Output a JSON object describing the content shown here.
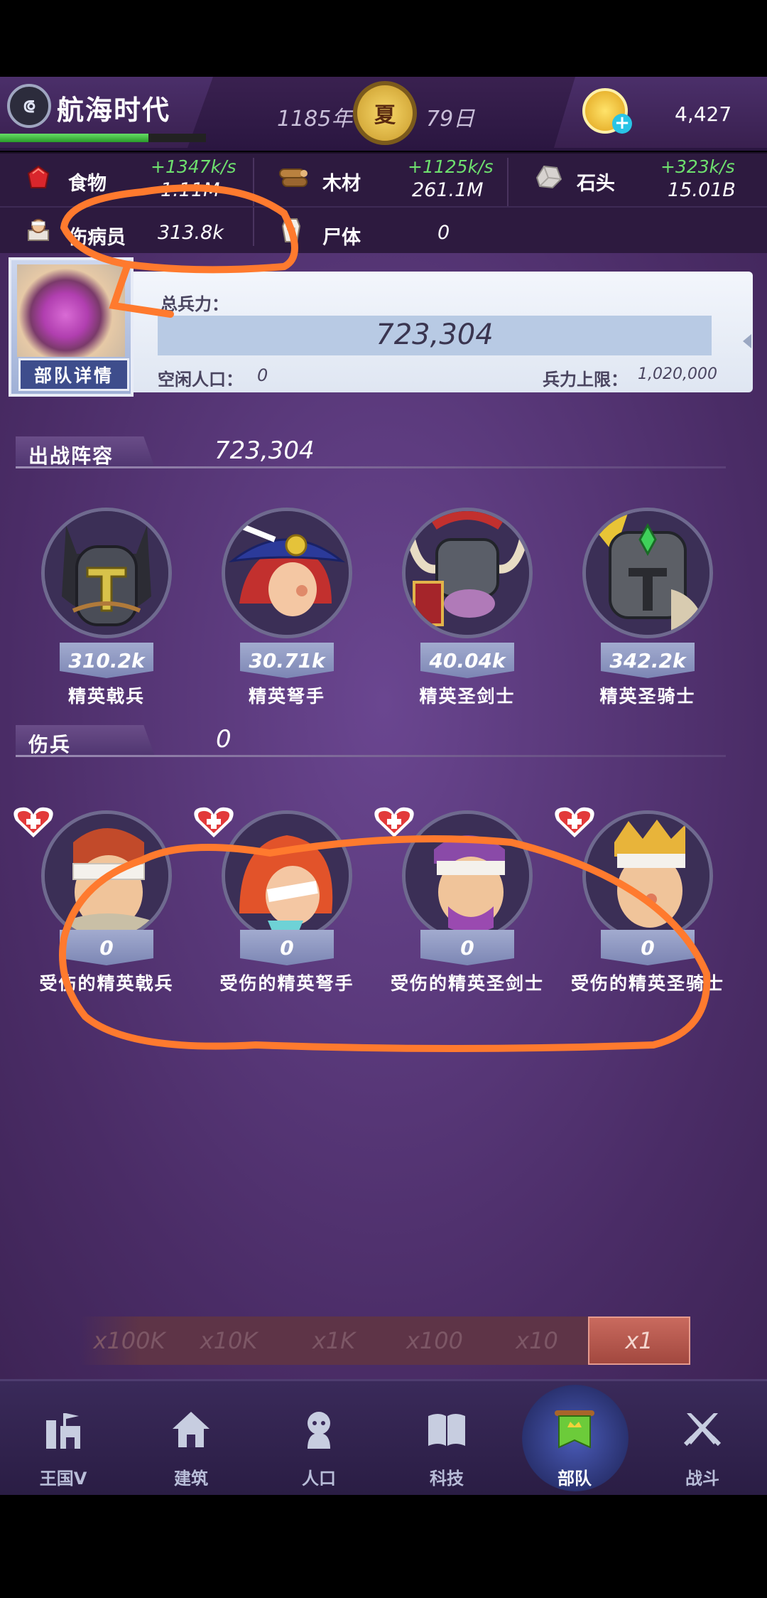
{
  "header": {
    "app_title": "航海时代",
    "era_icon": "era-badge-icon",
    "year": "1185年",
    "season": "夏",
    "day": "79日",
    "gold": "4,427",
    "xp_progress": 0.72
  },
  "resources": {
    "food": {
      "label": "食物",
      "rate": "+1347k/s",
      "value": "1.11M",
      "icon": "meat-icon"
    },
    "wood": {
      "label": "木材",
      "rate": "+1125k/s",
      "value": "261.1M",
      "icon": "log-icon"
    },
    "stone": {
      "label": "石头",
      "rate": "+323k/s",
      "value": "15.01B",
      "icon": "stone-icon"
    },
    "wounded": {
      "label": "伤病员",
      "value": "313.8k",
      "icon": "patient-icon"
    },
    "corpse": {
      "label": "尸体",
      "value": "0",
      "icon": "coffin-icon"
    }
  },
  "troops": {
    "total_label": "总兵力：",
    "total": "723,304",
    "idle_label": "空闲人口：",
    "idle_value": "0",
    "cap_label": "兵力上限：",
    "cap_value": "1,020,000",
    "detail_button": "部队详情"
  },
  "lineup": {
    "title": "出战阵容",
    "total": "723,304",
    "units": [
      {
        "name": "精英戟兵",
        "count": "310.2k"
      },
      {
        "name": "精英弩手",
        "count": "30.71k"
      },
      {
        "name": "精英圣剑士",
        "count": "40.04k"
      },
      {
        "name": "精英圣骑士",
        "count": "342.2k"
      }
    ]
  },
  "wounded": {
    "title": "伤兵",
    "total": "0",
    "units": [
      {
        "name": "受伤的精英戟兵",
        "count": "0"
      },
      {
        "name": "受伤的精英弩手",
        "count": "0"
      },
      {
        "name": "受伤的精英圣剑士",
        "count": "0"
      },
      {
        "name": "受伤的精英圣骑士",
        "count": "0"
      }
    ]
  },
  "multipliers": [
    "x100K",
    "x10K",
    "x1K",
    "x100",
    "x10",
    "x1"
  ],
  "multiplier_selected": "x1",
  "nav": [
    {
      "label": "王国Ⅴ",
      "icon": "castle-icon"
    },
    {
      "label": "建筑",
      "icon": "house-icon"
    },
    {
      "label": "人口",
      "icon": "person-icon"
    },
    {
      "label": "科技",
      "icon": "book-icon"
    },
    {
      "label": "部队",
      "icon": "banner-icon"
    },
    {
      "label": "战斗",
      "icon": "crossed-swords-icon"
    }
  ],
  "colors": {
    "background": "#5a3a7a",
    "rate_green": "#6ee06e",
    "annotation_orange": "#ff7a2e"
  }
}
